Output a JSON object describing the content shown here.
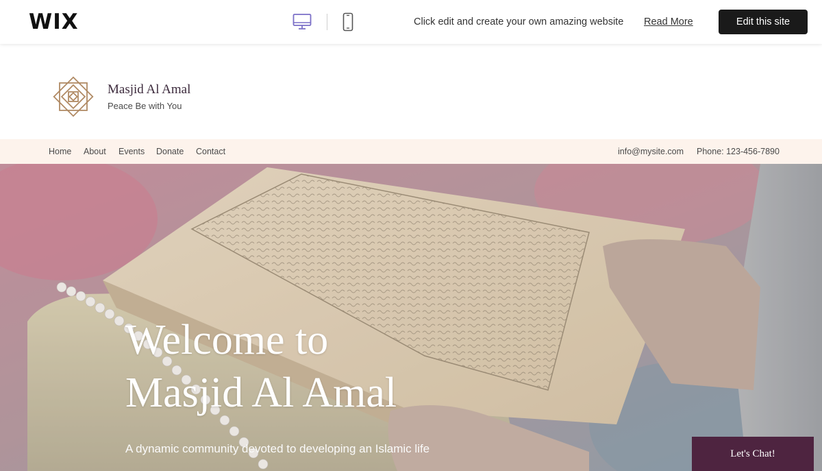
{
  "wix_bar": {
    "logo": "WIX",
    "desktop_icon": "desktop-icon",
    "mobile_icon": "mobile-icon",
    "promo_text": "Click edit and create your own amazing website",
    "read_more": "Read More",
    "edit_button": "Edit this site"
  },
  "site": {
    "logo_icon": "octagram-logo-icon",
    "name": "Masjid Al Amal",
    "tagline": "Peace Be with You"
  },
  "nav": {
    "items": [
      {
        "label": "Home"
      },
      {
        "label": "About"
      },
      {
        "label": "Events"
      },
      {
        "label": "Donate"
      },
      {
        "label": "Contact"
      }
    ],
    "email": "info@mysite.com",
    "phone": "Phone: 123-456-7890"
  },
  "hero": {
    "title_line1": "Welcome to",
    "title_line2": "Masjid Al Amal",
    "subtitle": "A dynamic community devoted to developing an Islamic life"
  },
  "chat": {
    "label": "Let's Chat!"
  },
  "colors": {
    "nav_background": "#fdf3ec",
    "chat_background": "#4e2440",
    "logo_gold": "#b08a64",
    "desktop_icon_accent": "#7a6fc7"
  }
}
